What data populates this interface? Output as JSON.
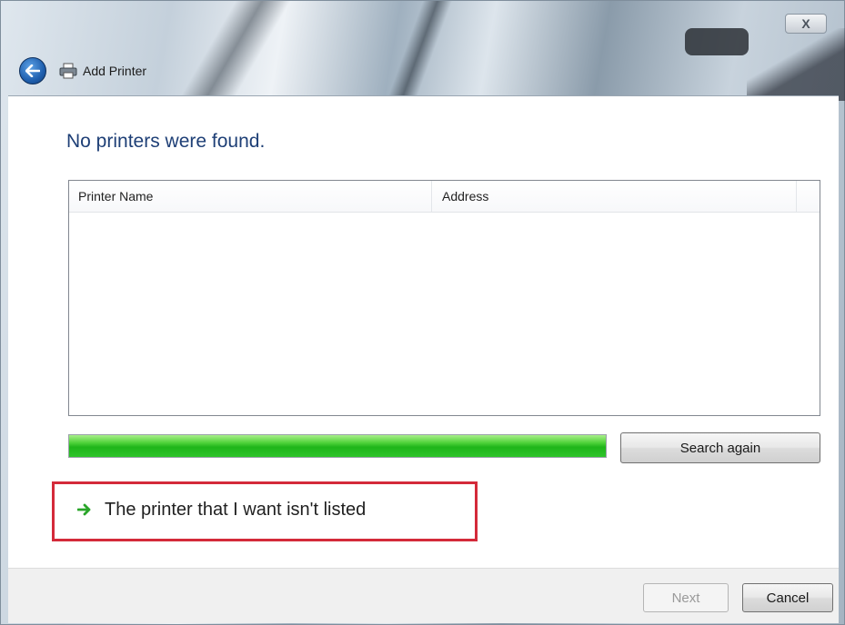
{
  "window": {
    "title": "Add Printer",
    "close_label": "X"
  },
  "main": {
    "heading": "No printers were found.",
    "list": {
      "columns": [
        "Printer Name",
        "Address"
      ],
      "rows": []
    },
    "progress": {
      "value_fraction": 1.0,
      "color": "#1fb51a"
    },
    "search_again_label": "Search again",
    "not_listed_label": "The printer that I want isn't listed",
    "highlight_color": "#d42a3a"
  },
  "footer": {
    "next_label": "Next",
    "cancel_label": "Cancel"
  },
  "icons": {
    "back": "back-arrow-icon",
    "printer": "printer-icon",
    "link_arrow": "green-arrow-icon"
  }
}
